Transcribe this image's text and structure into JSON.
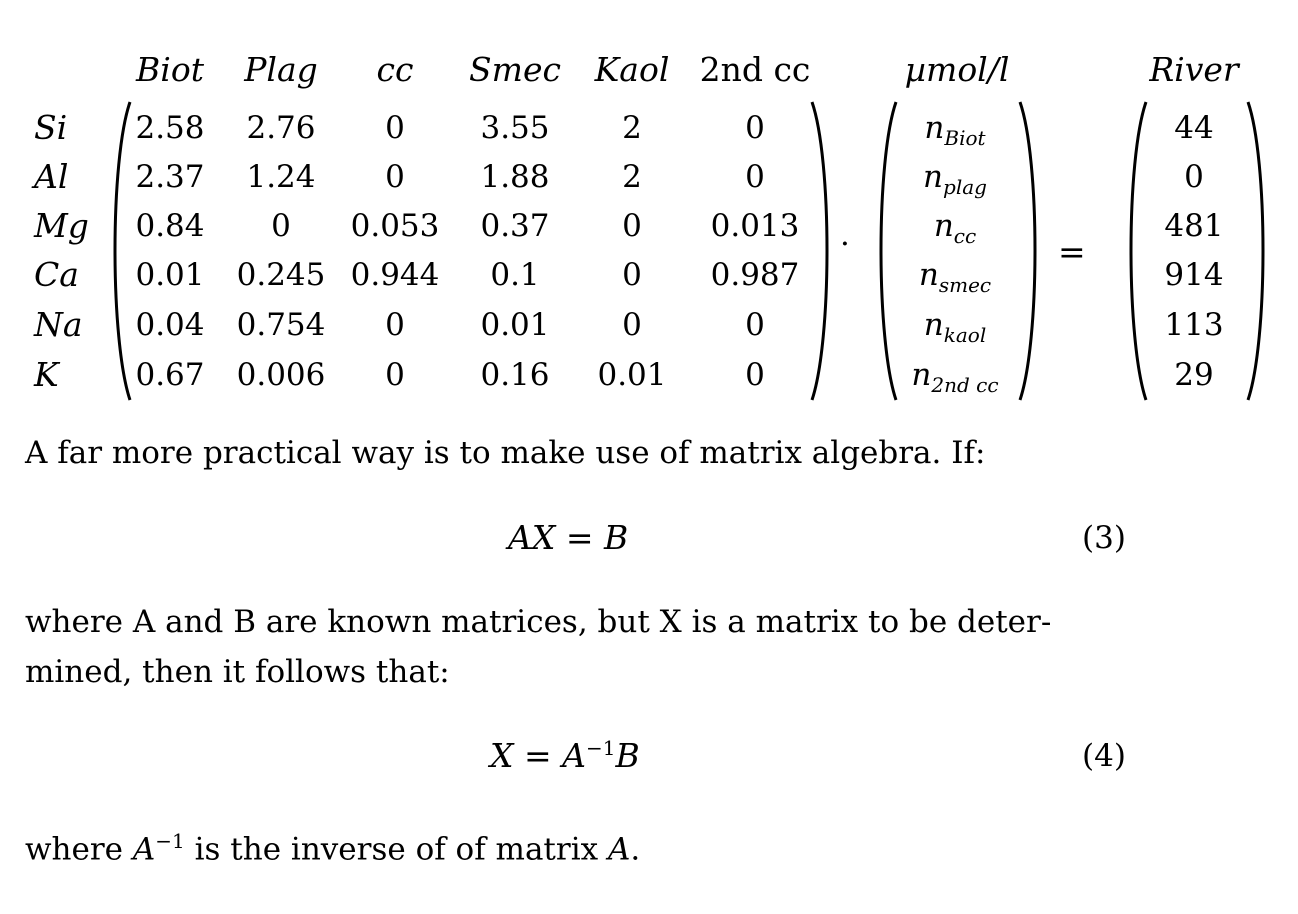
{
  "matrix": {
    "col_headers": [
      "Biot",
      "Plag",
      "cc",
      "Smec",
      "Kaol",
      "2nd cc"
    ],
    "row_labels": [
      "Si",
      "Al",
      "Mg",
      "Ca",
      "Na",
      "K"
    ],
    "rows": [
      [
        "2.58",
        "2.76",
        "0",
        "3.55",
        "2",
        "0"
      ],
      [
        "2.37",
        "1.24",
        "0",
        "1.88",
        "2",
        "0"
      ],
      [
        "0.84",
        "0",
        "0.053",
        "0.37",
        "0",
        "0.013"
      ],
      [
        "0.01",
        "0.245",
        "0.944",
        "0.1",
        "0",
        "0.987"
      ],
      [
        "0.04",
        "0.754",
        "0",
        "0.01",
        "0",
        "0"
      ],
      [
        "0.67",
        "0.006",
        "0",
        "0.16",
        "0.01",
        "0"
      ]
    ]
  },
  "dot_operator": "·",
  "unknowns": {
    "header": "µmol/l",
    "base": "n",
    "subscripts": [
      "Biot",
      "plag",
      "cc",
      "smec",
      "kaol",
      "2nd cc"
    ]
  },
  "equals": "=",
  "river": {
    "header": "River",
    "values": [
      "44",
      "0",
      "481",
      "914",
      "113",
      "29"
    ]
  },
  "paragraph1": "A far more practical way is to make use of matrix algebra. If:",
  "equation3": {
    "lhs": "AX",
    "op": "=",
    "rhs": "B",
    "number": "(3)"
  },
  "paragraph2_line1": "where A and B are known matrices, but X is a matrix to be deter-",
  "paragraph2_line2": "mined, then it follows that:",
  "equation4": {
    "lhs": "X",
    "op": "=",
    "rhs_base": "A",
    "rhs_sup": "−1",
    "rhs_tail": "B",
    "number": "(4)"
  },
  "paragraph3": {
    "pre": "where ",
    "var": "A",
    "sup": "−1",
    "mid": " is the inverse of of matrix ",
    "var2": "A",
    "end": "."
  }
}
